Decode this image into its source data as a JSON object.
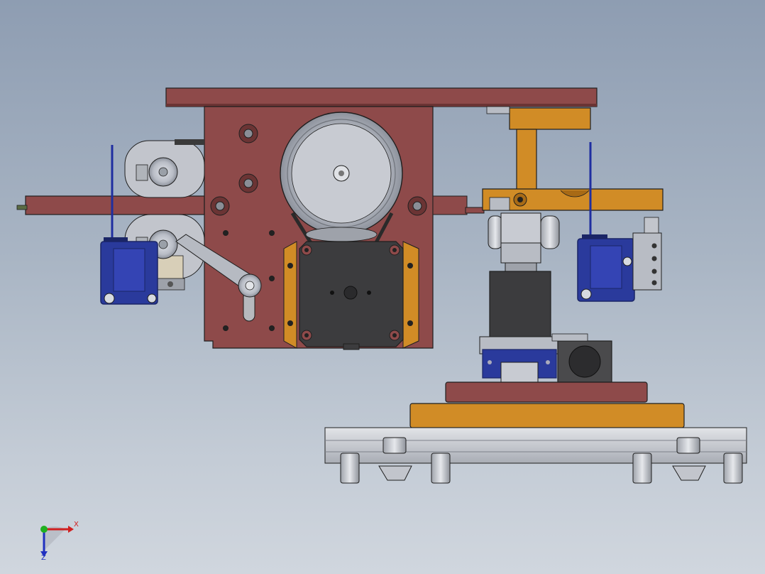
{
  "viewport": {
    "background_top": "#8e9db2",
    "background_bottom": "#d0d6de"
  },
  "colors": {
    "plate_red": "#8e4a4a",
    "plate_red_dark": "#6b3434",
    "bracket_orange": "#d18c26",
    "bracket_orange_dark": "#a86a15",
    "motor_dark": "#3c3c3e",
    "steel_gray": "#b8bcc4",
    "steel_light": "#d7dae0",
    "switch_blue": "#2a3a9c",
    "switch_blue_dark": "#1a2566",
    "aluminum_rail": "#c9ccd2",
    "outline": "#1f1f1f"
  },
  "triad": {
    "x_label": "X",
    "z_label": "Z",
    "x_color": "#d02020",
    "y_color": "#20b020",
    "z_color": "#2030c0"
  }
}
